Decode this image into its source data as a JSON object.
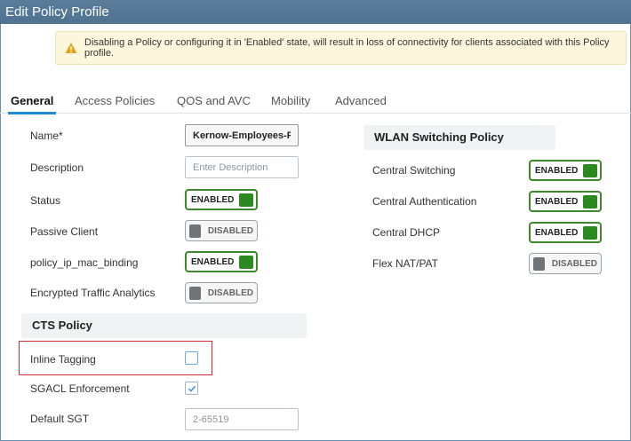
{
  "window": {
    "title": "Edit Policy Profile"
  },
  "warning": {
    "icon": "warning-triangle-icon",
    "text": "Disabling a Policy or configuring it in 'Enabled' state, will result in loss of connectivity for clients associated with this Policy profile."
  },
  "tabs": [
    {
      "label": "General",
      "active": true
    },
    {
      "label": "Access Policies"
    },
    {
      "label": "QOS and AVC"
    },
    {
      "label": "Mobility"
    },
    {
      "label": "Advanced"
    }
  ],
  "general": {
    "name_label": "Name*",
    "name_value": "Kernow-Employees-Po",
    "description_label": "Description",
    "description_placeholder": "Enter Description",
    "status_label": "Status",
    "status_state": "ENABLED",
    "passive_client_label": "Passive Client",
    "passive_client_state": "DISABLED",
    "ip_mac_binding_label": "policy_ip_mac_binding",
    "ip_mac_binding_state": "ENABLED",
    "eta_label": "Encrypted Traffic Analytics",
    "eta_state": "DISABLED"
  },
  "cts": {
    "title": "CTS Policy",
    "inline_tagging_label": "Inline Tagging",
    "inline_tagging_checked": false,
    "sgacl_label": "SGACL Enforcement",
    "sgacl_checked": true,
    "default_sgt_label": "Default SGT",
    "default_sgt_placeholder": "2-65519"
  },
  "wlan_switching": {
    "title": "WLAN Switching Policy",
    "central_switching_label": "Central Switching",
    "central_switching_state": "ENABLED",
    "central_auth_label": "Central Authentication",
    "central_auth_state": "ENABLED",
    "central_dhcp_label": "Central DHCP",
    "central_dhcp_state": "ENABLED",
    "flex_nat_label": "Flex NAT/PAT",
    "flex_nat_state": "DISABLED"
  },
  "colors": {
    "accent_tab": "#1f8ad6",
    "enabled_green": "#2b8a1f",
    "highlight_red": "#d22b35"
  }
}
